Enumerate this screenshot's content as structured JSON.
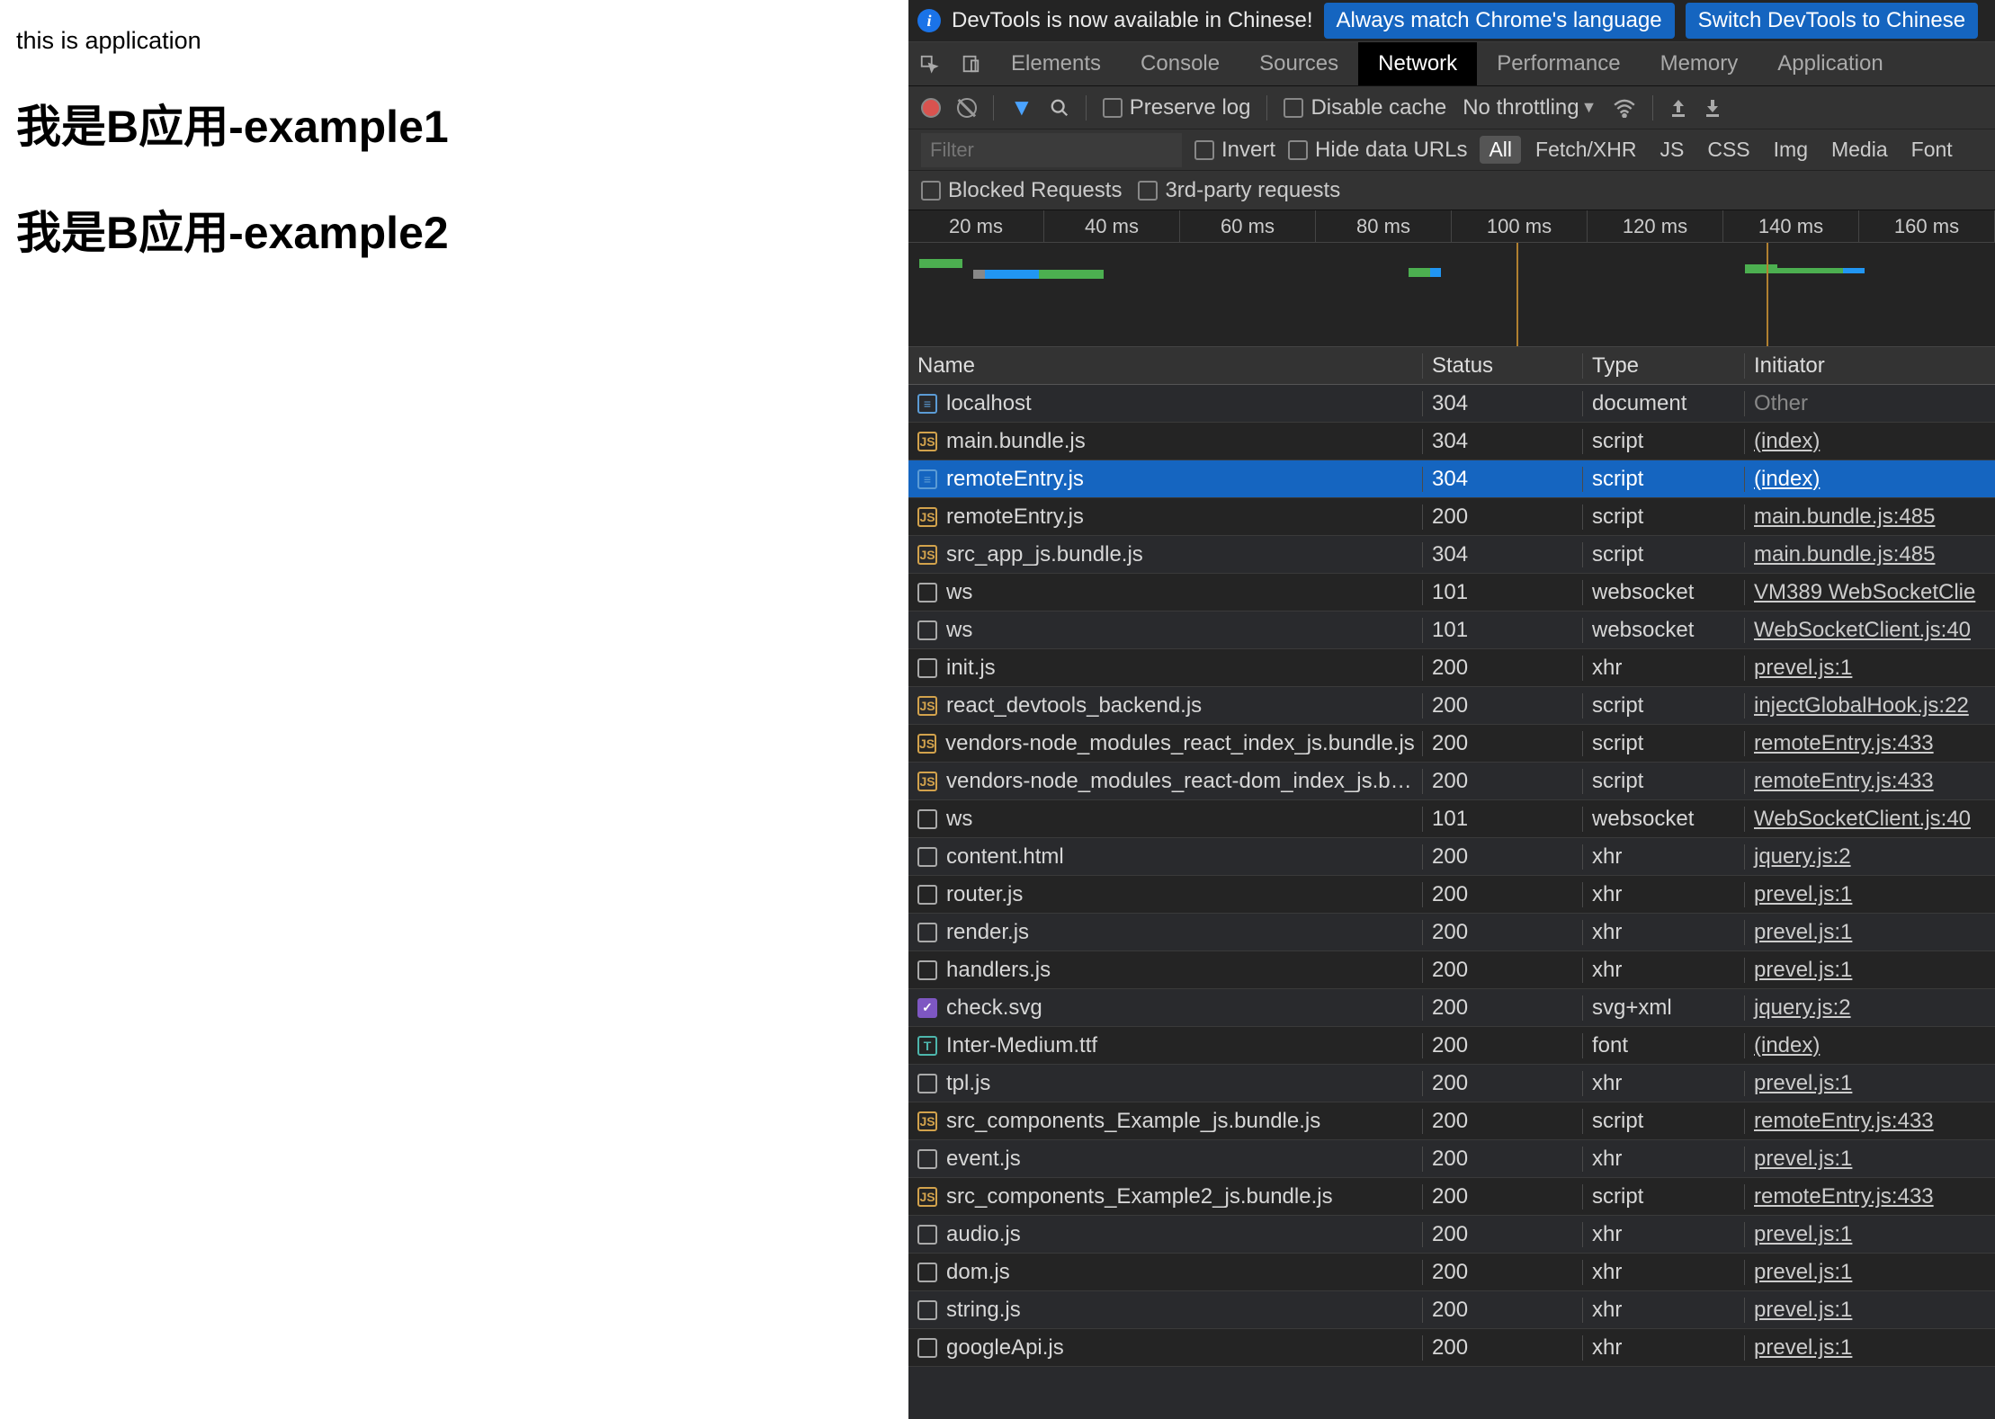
{
  "page": {
    "app_line": "this is application",
    "heading1": "我是B应用-example1",
    "heading2": "我是B应用-example2"
  },
  "infobar": {
    "message": "DevTools is now available in Chinese!",
    "btn_match": "Always match Chrome's language",
    "btn_switch": "Switch DevTools to Chinese"
  },
  "tabs": {
    "items": [
      {
        "label": "Elements",
        "active": false
      },
      {
        "label": "Console",
        "active": false
      },
      {
        "label": "Sources",
        "active": false
      },
      {
        "label": "Network",
        "active": true
      },
      {
        "label": "Performance",
        "active": false
      },
      {
        "label": "Memory",
        "active": false
      },
      {
        "label": "Application",
        "active": false
      }
    ]
  },
  "toolbar": {
    "preserve_log": "Preserve log",
    "disable_cache": "Disable cache",
    "throttling": "No throttling"
  },
  "filterbar": {
    "placeholder": "Filter",
    "invert": "Invert",
    "hide_data_urls": "Hide data URLs",
    "types": [
      "All",
      "Fetch/XHR",
      "JS",
      "CSS",
      "Img",
      "Media",
      "Font"
    ],
    "type_active": "All",
    "blocked": "Blocked Requests",
    "third_party": "3rd-party requests"
  },
  "timeline": {
    "ticks": [
      "20 ms",
      "40 ms",
      "60 ms",
      "80 ms",
      "100 ms",
      "120 ms",
      "140 ms",
      "160 ms"
    ]
  },
  "table": {
    "headers": {
      "name": "Name",
      "status": "Status",
      "type": "Type",
      "initiator": "Initiator"
    },
    "rows": [
      {
        "icon": "doc",
        "name": "localhost",
        "status": "304",
        "type": "document",
        "initiator": "Other",
        "init_other": true
      },
      {
        "icon": "js",
        "name": "main.bundle.js",
        "status": "304",
        "type": "script",
        "initiator": "(index)"
      },
      {
        "icon": "doc",
        "name": "remoteEntry.js",
        "status": "304",
        "type": "script",
        "initiator": "(index)",
        "selected": true
      },
      {
        "icon": "js",
        "name": "remoteEntry.js",
        "status": "200",
        "type": "script",
        "initiator": "main.bundle.js:485"
      },
      {
        "icon": "js",
        "name": "src_app_js.bundle.js",
        "status": "304",
        "type": "script",
        "initiator": "main.bundle.js:485"
      },
      {
        "icon": "gen",
        "name": "ws",
        "status": "101",
        "type": "websocket",
        "initiator": "VM389 WebSocketClie"
      },
      {
        "icon": "gen",
        "name": "ws",
        "status": "101",
        "type": "websocket",
        "initiator": "WebSocketClient.js:40"
      },
      {
        "icon": "gen",
        "name": "init.js",
        "status": "200",
        "type": "xhr",
        "initiator": "prevel.js:1"
      },
      {
        "icon": "js",
        "name": "react_devtools_backend.js",
        "status": "200",
        "type": "script",
        "initiator": "injectGlobalHook.js:22"
      },
      {
        "icon": "js",
        "name": "vendors-node_modules_react_index_js.bundle.js",
        "status": "200",
        "type": "script",
        "initiator": "remoteEntry.js:433"
      },
      {
        "icon": "js",
        "name": "vendors-node_modules_react-dom_index_js.b…",
        "status": "200",
        "type": "script",
        "initiator": "remoteEntry.js:433"
      },
      {
        "icon": "gen",
        "name": "ws",
        "status": "101",
        "type": "websocket",
        "initiator": "WebSocketClient.js:40"
      },
      {
        "icon": "gen",
        "name": "content.html",
        "status": "200",
        "type": "xhr",
        "initiator": "jquery.js:2"
      },
      {
        "icon": "gen",
        "name": "router.js",
        "status": "200",
        "type": "xhr",
        "initiator": "prevel.js:1"
      },
      {
        "icon": "gen",
        "name": "render.js",
        "status": "200",
        "type": "xhr",
        "initiator": "prevel.js:1"
      },
      {
        "icon": "gen",
        "name": "handlers.js",
        "status": "200",
        "type": "xhr",
        "initiator": "prevel.js:1"
      },
      {
        "icon": "img",
        "name": "check.svg",
        "status": "200",
        "type": "svg+xml",
        "initiator": "jquery.js:2"
      },
      {
        "icon": "font",
        "name": "Inter-Medium.ttf",
        "status": "200",
        "type": "font",
        "initiator": "(index)"
      },
      {
        "icon": "gen",
        "name": "tpl.js",
        "status": "200",
        "type": "xhr",
        "initiator": "prevel.js:1"
      },
      {
        "icon": "js",
        "name": "src_components_Example_js.bundle.js",
        "status": "200",
        "type": "script",
        "initiator": "remoteEntry.js:433"
      },
      {
        "icon": "gen",
        "name": "event.js",
        "status": "200",
        "type": "xhr",
        "initiator": "prevel.js:1"
      },
      {
        "icon": "js",
        "name": "src_components_Example2_js.bundle.js",
        "status": "200",
        "type": "script",
        "initiator": "remoteEntry.js:433"
      },
      {
        "icon": "gen",
        "name": "audio.js",
        "status": "200",
        "type": "xhr",
        "initiator": "prevel.js:1"
      },
      {
        "icon": "gen",
        "name": "dom.js",
        "status": "200",
        "type": "xhr",
        "initiator": "prevel.js:1"
      },
      {
        "icon": "gen",
        "name": "string.js",
        "status": "200",
        "type": "xhr",
        "initiator": "prevel.js:1"
      },
      {
        "icon": "gen",
        "name": "googleApi.js",
        "status": "200",
        "type": "xhr",
        "initiator": "prevel.js:1"
      }
    ]
  }
}
